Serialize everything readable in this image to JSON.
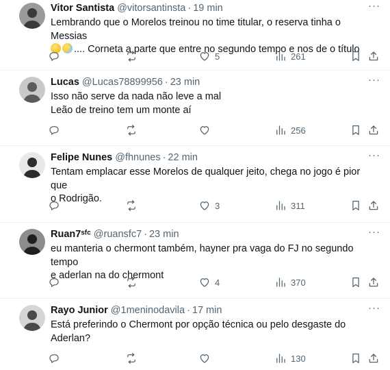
{
  "replies": [
    {
      "name": "Vitor Santista",
      "handle": "@vitorsantinsta",
      "time": "19 min",
      "lines": [
        "Lembrando que o Morelos treinou no time titular, o reserva tinha o Messias"
      ],
      "emoji_line_tail": ".... Corneta a parte que entre no segundo tempo e nos de o título",
      "emojis": [
        "shushing-face-emoji",
        "grinning-sweat-face-emoji"
      ],
      "replies_count": "",
      "reposts_count": "",
      "likes_count": "5",
      "views_count": "261",
      "avatar_colors": [
        "#9a9a9a",
        "#3a3a3a"
      ]
    },
    {
      "name": "Lucas",
      "handle": "@Lucas78899956",
      "time": "23 min",
      "lines": [
        "Isso não serve da nada não leve a mal",
        "Leão de treino tem um monte aí"
      ],
      "replies_count": "",
      "reposts_count": "",
      "likes_count": "",
      "views_count": "256",
      "avatar_colors": [
        "#c9c9c9",
        "#5b5b5b"
      ]
    },
    {
      "name": "Felipe Nunes",
      "handle": "@fhnunes",
      "time": "22 min",
      "lines": [
        "Tentam emplacar esse Morelos de qualquer jeito, chega no jogo é pior que",
        "o Rodrigão."
      ],
      "replies_count": "",
      "reposts_count": "",
      "likes_count": "3",
      "views_count": "311",
      "avatar_colors": [
        "#e8e8e8",
        "#2c2c2c"
      ]
    },
    {
      "name": "Ruan7ˢᶠᶜ",
      "handle": "@ruansfc7",
      "time": "23 min",
      "lines": [
        "eu manteria o chermont também, hayner pra vaga do FJ no segundo tempo",
        "e aderlan na do chermont"
      ],
      "replies_count": "",
      "reposts_count": "",
      "likes_count": "4",
      "views_count": "370",
      "avatar_colors": [
        "#8c8c8c",
        "#1f1f1f"
      ]
    },
    {
      "name": "Rayo Junior",
      "handle": "@1meninodavila",
      "time": "17 min",
      "lines": [
        "Está preferindo o Chermont por opção técnica ou pelo desgaste do",
        "Aderlan?"
      ],
      "replies_count": "",
      "reposts_count": "",
      "likes_count": "",
      "views_count": "130",
      "avatar_colors": [
        "#d5d5d5",
        "#4a4a4a"
      ]
    }
  ],
  "icons": {
    "reply": "reply-icon",
    "repost": "repost-icon",
    "like": "like-icon",
    "views": "views-icon",
    "bookmark": "bookmark-icon",
    "share": "share-icon",
    "more": "more-icon"
  },
  "colors": {
    "text": "#0f1419",
    "muted": "#536471",
    "divider": "#eff3f4"
  }
}
